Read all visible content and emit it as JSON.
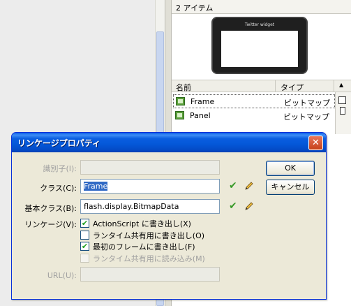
{
  "library": {
    "item_count": "2 アイテム",
    "preview_title": "Twitter widget",
    "columns": {
      "name": "名前",
      "type": "タイプ"
    },
    "items": [
      {
        "name": "Frame",
        "type": "ビットマップ",
        "icon": "bitmap-icon"
      },
      {
        "name": "Panel",
        "type": "ビットマップ",
        "icon": "bitmap-icon"
      }
    ]
  },
  "dialog": {
    "title": "リンケージプロパティ",
    "close_glyph": "✕",
    "identifier": {
      "label": "識別子(I):",
      "value": ""
    },
    "class": {
      "label": "クラス(C):",
      "value": "Frame"
    },
    "base_class": {
      "label": "基本クラス(B):",
      "value": "flash.display.BitmapData"
    },
    "linkage_label": "リンケージ(V):",
    "options": [
      {
        "label": "ActionScript に書き出し(X)",
        "checked": true,
        "enabled": true
      },
      {
        "label": "ランタイム共有用に書き出し(O)",
        "checked": false,
        "enabled": true
      },
      {
        "label": "最初のフレームに書き出し(F)",
        "checked": true,
        "enabled": true
      },
      {
        "label": "ランタイム共有用に読み込み(M)",
        "checked": false,
        "enabled": false
      }
    ],
    "url": {
      "label": "URL(U):",
      "value": ""
    },
    "ok_label": "OK",
    "cancel_label": "キャンセル",
    "check_glyph": "✔"
  },
  "colors": {
    "accent": "#0a5ee0",
    "check": "#3a9a2a",
    "selection": "#316ac5"
  }
}
